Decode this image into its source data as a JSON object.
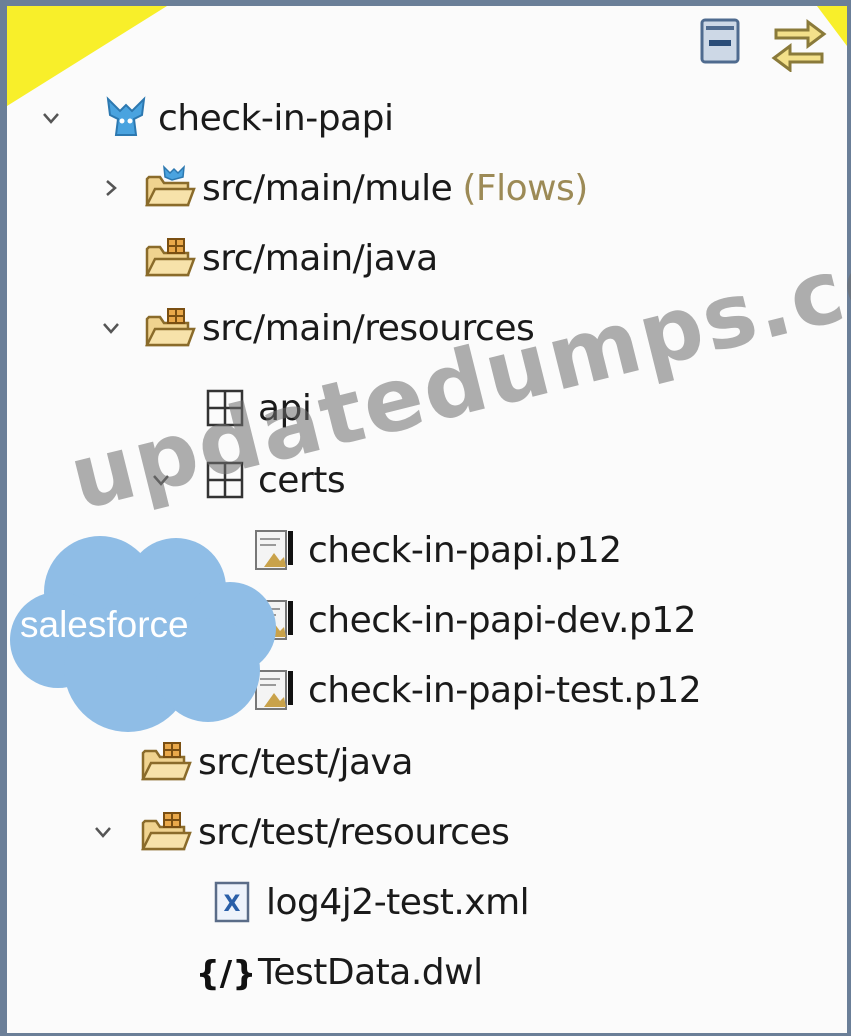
{
  "toolbar": {
    "collapse_icon": "collapse-all-icon",
    "link_icon": "link-with-editor-icon"
  },
  "tree": {
    "project": {
      "label": "check-in-papi",
      "icon": "mule-project-icon",
      "expanded": true
    },
    "items": [
      {
        "label": "src/main/mule",
        "decoration": "(Flows)",
        "icon": "mule-flows-folder-icon",
        "expander": "collapsed"
      },
      {
        "label": "src/main/java",
        "icon": "source-folder-icon"
      },
      {
        "label": "src/main/resources",
        "icon": "source-folder-icon",
        "expander": "expanded"
      },
      {
        "label": "api",
        "icon": "package-icon"
      },
      {
        "label": "certs",
        "icon": "package-icon",
        "expander": "expanded"
      },
      {
        "label": "check-in-papi.p12",
        "icon": "certificate-file-icon"
      },
      {
        "label": "check-in-papi-dev.p12",
        "icon": "certificate-file-icon"
      },
      {
        "label": "check-in-papi-test.p12",
        "icon": "certificate-file-icon"
      },
      {
        "label": "src/test/java",
        "icon": "source-folder-icon"
      },
      {
        "label": "src/test/resources",
        "icon": "source-folder-icon",
        "expander": "expanded"
      },
      {
        "label": "log4j2-test.xml",
        "icon": "xml-file-icon"
      },
      {
        "label": "TestData.dwl",
        "icon": "dataweave-file-icon"
      }
    ]
  },
  "watermark": {
    "text": "updatedumps.com",
    "badge": "salesforce"
  },
  "colors": {
    "frame": "#6b7f98",
    "accent": "#f8ef2a",
    "folder": "#e8c77a",
    "cloud": "#8fbde6"
  }
}
